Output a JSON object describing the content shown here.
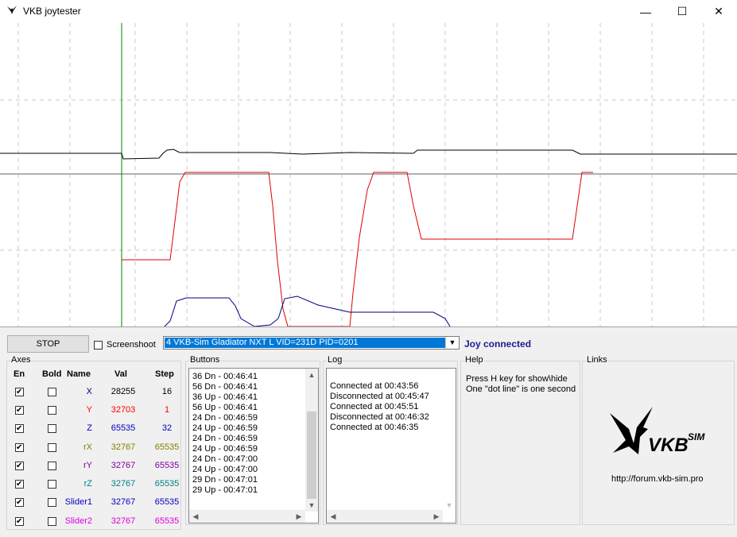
{
  "window": {
    "title": "VKB joytester",
    "minimize": "—",
    "maximize": "☐",
    "close": "✕"
  },
  "toolbar": {
    "stop_label": "STOP",
    "screenshoot_label": "Screenshoot",
    "screenshoot_checked": false,
    "device_selected": "4  VKB-Sim Gladiator NXT L   VID=231D PID=0201",
    "status": "Joy connected"
  },
  "axes": {
    "group_label": "Axes",
    "headers": {
      "en": "En",
      "bold": "Bold",
      "name": "Name",
      "val": "Val",
      "step": "Step"
    },
    "rows": [
      {
        "name": "X",
        "val": "28255",
        "step": "16",
        "color": "#000080",
        "en": true,
        "bold": false
      },
      {
        "name": "Y",
        "val": "32703",
        "step": "1",
        "color": "#ff0000",
        "en": true,
        "bold": false
      },
      {
        "name": "Z",
        "val": "65535",
        "step": "32",
        "color": "#0000c0",
        "en": true,
        "bold": false
      },
      {
        "name": "rX",
        "val": "32767",
        "step": "65535",
        "color": "#808000",
        "en": true,
        "bold": false
      },
      {
        "name": "rY",
        "val": "32767",
        "step": "65535",
        "color": "#8000a0",
        "en": true,
        "bold": false
      },
      {
        "name": "rZ",
        "val": "32767",
        "step": "65535",
        "color": "#008080",
        "en": true,
        "bold": false
      },
      {
        "name": "Slider1",
        "val": "32767",
        "step": "65535",
        "color": "#0000c0",
        "en": true,
        "bold": false
      },
      {
        "name": "Slider2",
        "val": "32767",
        "step": "65535",
        "color": "#e000e0",
        "en": true,
        "bold": false
      }
    ]
  },
  "buttons": {
    "group_label": "Buttons",
    "lines": [
      "36 Dn - 00:46:41",
      "56 Dn - 00:46:41",
      "36 Up - 00:46:41",
      "56 Up - 00:46:41",
      "24 Dn - 00:46:59",
      "24 Up - 00:46:59",
      "24 Dn - 00:46:59",
      "24 Up - 00:46:59",
      "24 Dn - 00:47:00",
      "24 Up - 00:47:00",
      "29 Dn - 00:47:01",
      "29 Up - 00:47:01"
    ]
  },
  "log": {
    "group_label": "Log",
    "lines": [
      "Connected at 00:43:56",
      "Disconnected at 00:45:47",
      "Connected at 00:45:51",
      "Disconnected at 00:46:32",
      "Connected at 00:46:35"
    ]
  },
  "help": {
    "group_label": "Help",
    "line1": "Press H key for show\\hide",
    "line2": "One \"dot line\" is one second"
  },
  "links": {
    "group_label": "Links",
    "logo_text": "VKBsim",
    "url": "http://forum.vkb-sim.pro"
  }
}
